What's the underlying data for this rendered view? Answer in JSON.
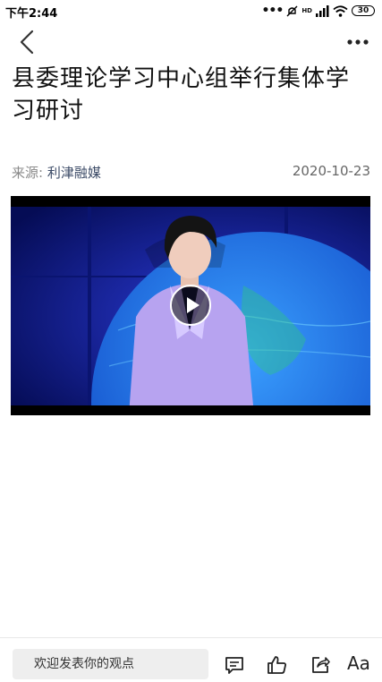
{
  "status_bar": {
    "time": "下午2:44",
    "network_badge": "HD",
    "battery": "30"
  },
  "article": {
    "title": "县委理论学习中心组举行集体学习研讨",
    "source_label": "来源:",
    "source_name": "利津融媒",
    "date": "2020-10-23"
  },
  "comment_bar": {
    "placeholder": "欢迎发表你的观点",
    "font_button_label": "Aa"
  },
  "icons": {
    "back": "chevron-left-icon",
    "more": "more-dots-icon",
    "play": "play-icon",
    "comment": "comment-icon",
    "like": "thumbs-up-icon",
    "share": "share-icon"
  },
  "colors": {
    "source_name": "#3b4a66",
    "video_background": "#0a1a8a"
  }
}
